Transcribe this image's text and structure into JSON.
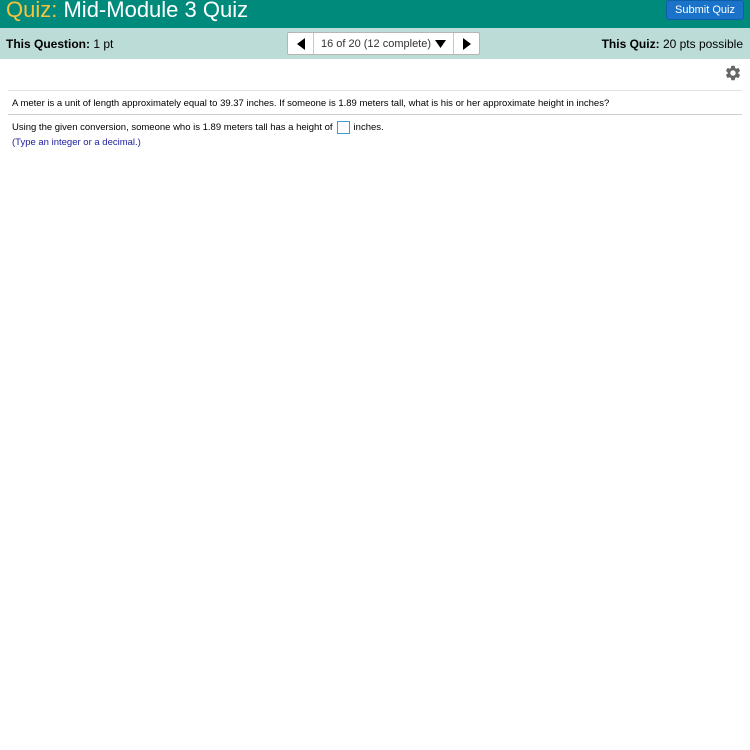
{
  "header": {
    "title_prefix": "Quiz:",
    "title": "Mid-Module 3 Quiz",
    "submit_label": "Submit Quiz"
  },
  "info": {
    "this_question_label": "This Question:",
    "this_question_value": "1 pt",
    "this_quiz_label": "This Quiz:",
    "this_quiz_value": "20 pts possible"
  },
  "nav": {
    "position": "16 of 20 (12 complete)",
    "prev_icon": "triangle-left-icon",
    "next_icon": "triangle-right-icon",
    "dropdown_icon": "caret-down-icon"
  },
  "settings": {
    "icon": "gear-icon"
  },
  "question": {
    "text": "A meter is a unit of length approximately equal to 39.37 inches. If someone is 1.89 meters tall, what is his or her approximate height in inches?",
    "answer_prefix": "Using the given conversion, someone who is 1.89 meters tall has a height of",
    "answer_suffix": "inches.",
    "answer_value": "",
    "hint": "(Type an integer or a decimal.)"
  },
  "colors": {
    "header_bg": "#008a7c",
    "title_prefix": "#f9c23c",
    "info_bar_bg": "#bcdcd7",
    "submit_bg": "#1a73c9",
    "hint_text": "#2020a0",
    "input_border": "#3a9ecf"
  }
}
